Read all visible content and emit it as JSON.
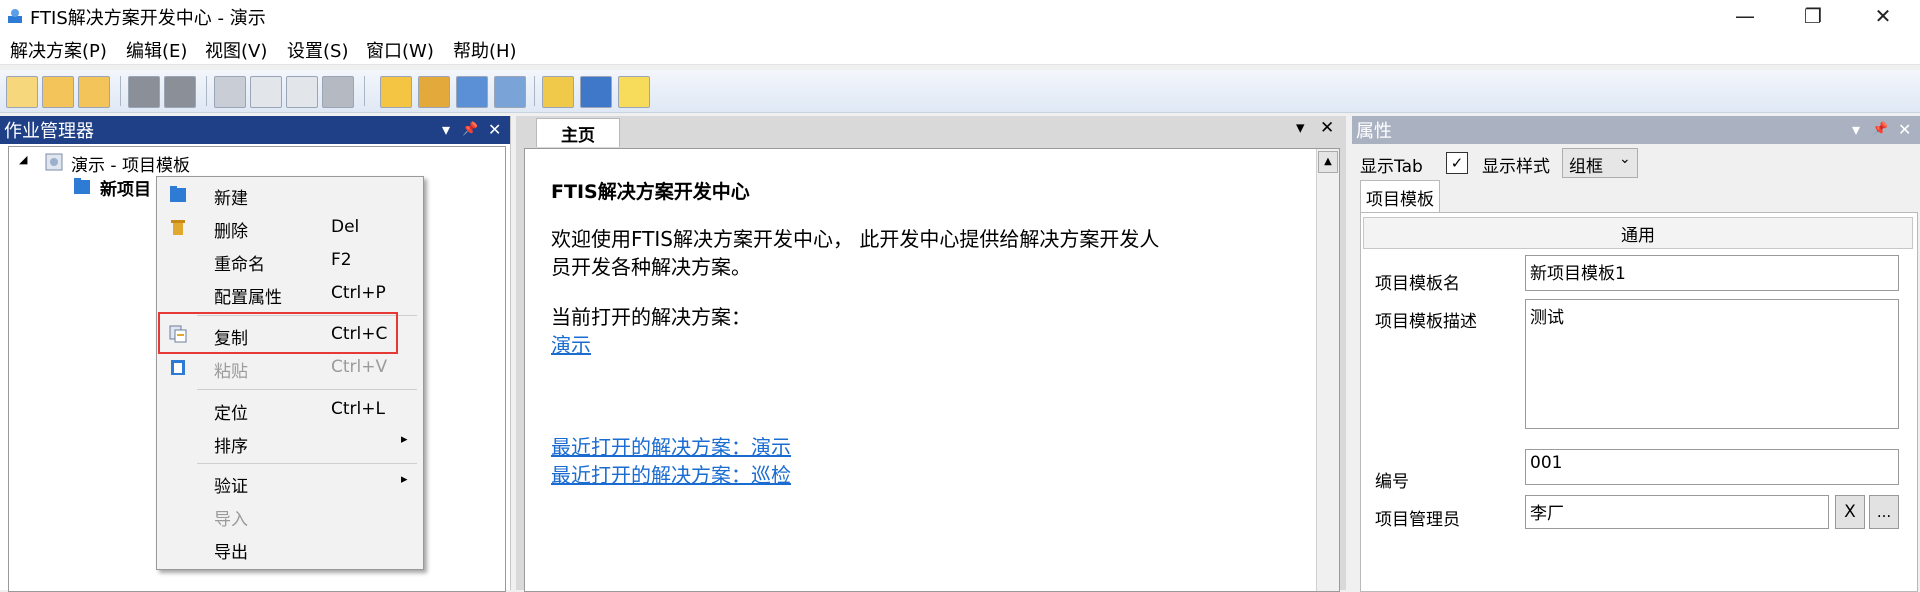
{
  "window": {
    "title": "FTIS解决方案开发中心 - 演示",
    "minimize": "—",
    "restore": "❐",
    "close": "✕"
  },
  "menu": [
    "解决方案(P)",
    "编辑(E)",
    "视图(V)",
    "设置(S)",
    "窗口(W)",
    "帮助(H)"
  ],
  "toolbar": {
    "icons": [
      "new-solution-icon",
      "open-folder-icon",
      "open-project-icon",
      "save-icon",
      "save-all-icon",
      "cut-icon",
      "copy-icon",
      "paste-icon",
      "delete-icon",
      "edit-icon",
      "build-icon",
      "sync-icon",
      "print-icon",
      "flag-icon",
      "grid-icon",
      "notes-icon"
    ]
  },
  "left_panel": {
    "title": "作业管理器",
    "pane_dropdown": "▾",
    "pane_pin": "📌",
    "pane_close": "✕",
    "tree_toggle": "◢",
    "tree_root": "演示 - 项目模板",
    "tree_child": "新项目"
  },
  "context_menu": [
    {
      "label": "新建",
      "shortcut": "",
      "icon": "new-icon",
      "enabled": true
    },
    {
      "label": "删除",
      "shortcut": "Del",
      "icon": "trash-icon",
      "enabled": true
    },
    {
      "label": "重命名",
      "shortcut": "F2",
      "icon": "",
      "enabled": true
    },
    {
      "label": "配置属性",
      "shortcut": "Ctrl+P",
      "icon": "",
      "enabled": true
    },
    {
      "label": "复制",
      "shortcut": "Ctrl+C",
      "icon": "copy-icon",
      "enabled": true
    },
    {
      "label": "粘贴",
      "shortcut": "Ctrl+V",
      "icon": "paste-icon",
      "enabled": false
    },
    {
      "label": "定位",
      "shortcut": "Ctrl+L",
      "icon": "",
      "enabled": true
    },
    {
      "label": "排序",
      "shortcut": "",
      "icon": "",
      "enabled": true,
      "submenu": "▸"
    },
    {
      "label": "验证",
      "shortcut": "",
      "icon": "",
      "enabled": true,
      "submenu": "▸"
    },
    {
      "label": "导入",
      "shortcut": "",
      "icon": "",
      "enabled": false
    },
    {
      "label": "导出",
      "shortcut": "",
      "icon": "",
      "enabled": true
    }
  ],
  "center": {
    "tab": "主页",
    "tab_dropdown": "▾",
    "tab_close": "✕",
    "scroll_up": "▲",
    "heading": "FTIS解决方案开发中心",
    "welcome_line1": "欢迎使用FTIS解决方案开发中心， 此开发中心提供给解决方案开发人",
    "welcome_line2": "员开发各种解决方案。",
    "current_label": "当前打开的解决方案：",
    "current_link": "演示",
    "recent_1": "最近打开的解决方案：演示",
    "recent_2": "最近打开的解决方案：巡检"
  },
  "properties": {
    "title": "属性",
    "pane_dropdown": "▾",
    "pane_pin": "📌",
    "pane_close": "✕",
    "show_tab_label": "显示Tab",
    "show_tab_checked": true,
    "show_tab_mark": "✓",
    "show_style_label": "显示样式",
    "style_value": "组框",
    "style_arrow": "⌄",
    "tab": "项目模板",
    "group": "通用",
    "fields": [
      {
        "label": "项目模板名",
        "value": "新项目模板1"
      },
      {
        "label": "项目模板描述",
        "value": "测试"
      },
      {
        "label": "编号",
        "value": "001"
      },
      {
        "label": "项目管理员",
        "value": "李厂"
      }
    ],
    "clear_button": "X",
    "browse_button": "..."
  },
  "colors": {
    "active_pane_header": "#1f3f86",
    "inactive_pane_header": "#aab2c2",
    "link": "#1b6cd0",
    "highlight_box": "#e53935"
  }
}
